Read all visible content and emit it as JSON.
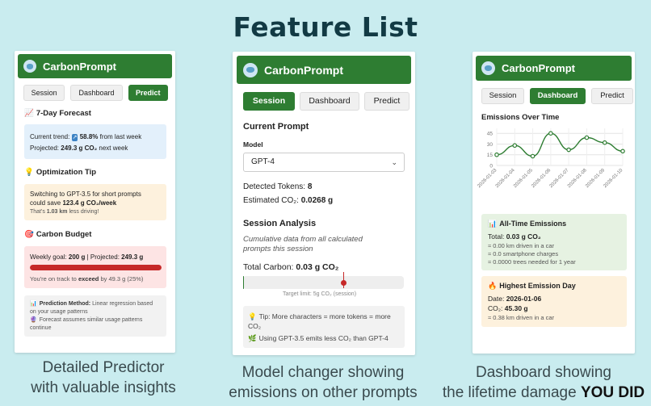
{
  "page": {
    "title": "Feature List"
  },
  "captions": {
    "left_line1": "Detailed Predictor",
    "left_line2": "with valuable insights",
    "mid_line1": "Model changer showing",
    "mid_line2": "emissions on other prompts",
    "right_line1": "Dashboard showing",
    "right_line2_prefix": "the lifetime damage",
    "right_line2_bold": "YOU DID"
  },
  "app": {
    "name": "CarbonPrompt"
  },
  "tabs": {
    "session": "Session",
    "dashboard": "Dashboard",
    "predict": "Predict"
  },
  "predict": {
    "forecast_title": "7-Day Forecast",
    "forecast_icon": "📈",
    "trend_prefix": "Current trend:",
    "trend_icon": "↗",
    "trend_value": "58.8%",
    "trend_suffix": "from last week",
    "projected_prefix": "Projected:",
    "projected_value": "249.3 g CO₂",
    "projected_suffix": "next week",
    "tip_title": "Optimization Tip",
    "tip_icon": "💡",
    "tip_line1": "Switching to GPT-3.5 for short prompts",
    "tip_line2_prefix": "could save",
    "tip_line2_value": "123.4 g CO₂/week",
    "tip_line3_prefix": "That's",
    "tip_line3_value": "1.03 km",
    "tip_line3_suffix": "less driving!",
    "budget_title": "Carbon Budget",
    "budget_icon": "🎯",
    "budget_goal_prefix": "Weekly goal:",
    "budget_goal_value": "200 g",
    "budget_proj_prefix": "| Projected:",
    "budget_proj_value": "249.3 g",
    "budget_fill": 1.0,
    "budget_status_prefix": "You're on track to",
    "budget_status_bold": "exceed",
    "budget_status_suffix": "by 49.3 g (25%)",
    "method_icon": "📊",
    "method_title": "Prediction Method:",
    "method_text1": "Linear regression based",
    "method_text2": "on your usage patterns",
    "forecast_note_icon": "🔮",
    "forecast_note1": "Forecast assumes similar usage patterns",
    "forecast_note2": "continue"
  },
  "session": {
    "current_prompt_title": "Current Prompt",
    "model_label": "Model",
    "model_value": "GPT-4",
    "tokens_label": "Detected Tokens:",
    "tokens_value": "8",
    "co2_label": "Estimated CO₂:",
    "co2_value": "0.0268 g",
    "analysis_title": "Session Analysis",
    "analysis_desc1": "Cumulative data from all calculated",
    "analysis_desc2": "prompts this session",
    "total_label": "Total Carbon:",
    "total_value": "0.03 g CO₂",
    "target_label": "Target limit: 5g CO₂ (session)",
    "total_fraction": 0.006,
    "tip_icon": "💡",
    "tip1_line1": "Tip: More characters = more tokens = more",
    "tip1_line2": "CO₂",
    "tip2_icon": "🌿",
    "tip2": "Using GPT-3.5 emits less CO₂ than GPT-4"
  },
  "dashboard": {
    "chart_title": "Emissions Over Time",
    "alltime_icon": "📊",
    "alltime_title": "All-Time Emissions",
    "total_prefix": "Total:",
    "total_value": "0.03 g CO₂",
    "eq1": "≈ 0.00 km driven in a car",
    "eq2": "≈ 0.0 smartphone charges",
    "eq3": "≈ 0.0000 trees needed for 1 year",
    "highest_icon": "🔥",
    "highest_title": "Highest Emission Day",
    "date_prefix": "Date:",
    "date_value": "2026-01-06",
    "co2_prefix": "CO₂:",
    "co2_value": "45.30 g",
    "eq4": "≈ 0.38 km driven in a car"
  },
  "chart_data": {
    "type": "line",
    "title": "Emissions Over Time",
    "x": [
      "2026-01-03",
      "2026-01-04",
      "2026-01-05",
      "2026-01-06",
      "2026-01-07",
      "2026-01-08",
      "2026-01-09",
      "2026-01-10"
    ],
    "series": [
      {
        "values": [
          15,
          28,
          13,
          45,
          22,
          39,
          32,
          20
        ]
      }
    ],
    "yticks": [
      0,
      15,
      30,
      45
    ],
    "ytick_labels": [
      "0",
      "15",
      "30",
      "45"
    ],
    "ylim": [
      0,
      52
    ],
    "grid": true,
    "color": "#2e7d32"
  }
}
